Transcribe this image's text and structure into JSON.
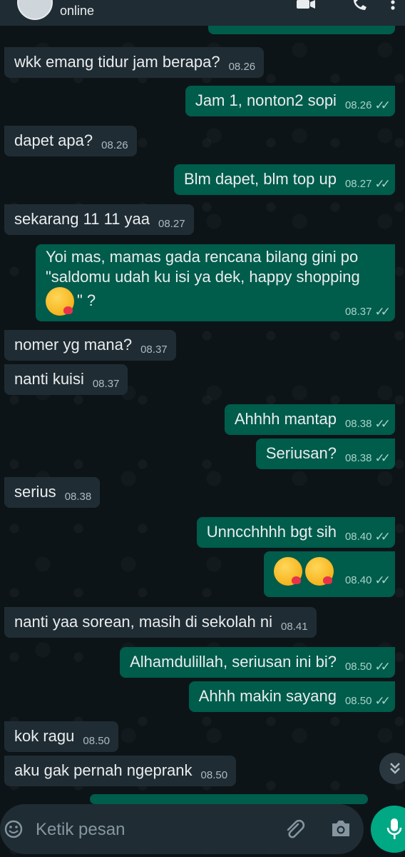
{
  "header": {
    "status": "online"
  },
  "messages": [
    {
      "dir": "in",
      "text": "wkk emang tidur jam berapa?",
      "time": "08.26"
    },
    {
      "dir": "out",
      "text": "Jam 1, nonton2 sopi",
      "time": "08.26"
    },
    {
      "dir": "in",
      "text": "dapet apa?",
      "time": "08.26"
    },
    {
      "dir": "out",
      "text": "Blm dapet, blm top up",
      "time": "08.27"
    },
    {
      "dir": "in",
      "text": "sekarang 11 11 yaa",
      "time": "08.27"
    },
    {
      "dir": "out",
      "line1": "Yoi mas, mamas gada rencana bilang gini po",
      "line2": "\"saldomu udah ku isi ya dek, happy shopping",
      "line3": "\" ?",
      "time": "08.37"
    },
    {
      "dir": "in",
      "text": "nomer yg mana?",
      "time": "08.37"
    },
    {
      "dir": "in",
      "text": "nanti kuisi",
      "time": "08.37"
    },
    {
      "dir": "out",
      "text": "Ahhhh mantap",
      "time": "08.38"
    },
    {
      "dir": "out",
      "text": "Seriusan?",
      "time": "08.38"
    },
    {
      "dir": "in",
      "text": "serius",
      "time": "08.38"
    },
    {
      "dir": "out",
      "text": "Unncchhhh bgt sih",
      "time": "08.40"
    },
    {
      "dir": "out",
      "text": "",
      "time": "08.40"
    },
    {
      "dir": "in",
      "text": "nanti yaa sorean, masih di sekolah ni",
      "time": "08.41"
    },
    {
      "dir": "out",
      "text": "Alhamdulillah, seriusan ini bi?",
      "time": "08.50"
    },
    {
      "dir": "out",
      "text": "Ahhh makin sayang",
      "time": "08.50"
    },
    {
      "dir": "in",
      "text": "kok ragu",
      "time": "08.50"
    },
    {
      "dir": "in",
      "text": "aku gak pernah ngeprank",
      "time": "08.50"
    }
  ],
  "input": {
    "placeholder": "Ketik pesan"
  },
  "icons": {
    "back": "arrow-left-icon",
    "video": "video-call-icon",
    "call": "phone-icon",
    "menu": "more-vert-icon",
    "emoji": "emoji-icon",
    "attach": "paperclip-icon",
    "camera": "camera-icon",
    "mic": "mic-icon",
    "scroll": "chevron-double-down-icon",
    "read": "double-check-icon"
  },
  "colors": {
    "background": "#0b141a",
    "incoming_bubble": "#202c33",
    "outgoing_bubble": "#005c4b",
    "read_ticks": "#53bdeb",
    "accent": "#00a884"
  }
}
